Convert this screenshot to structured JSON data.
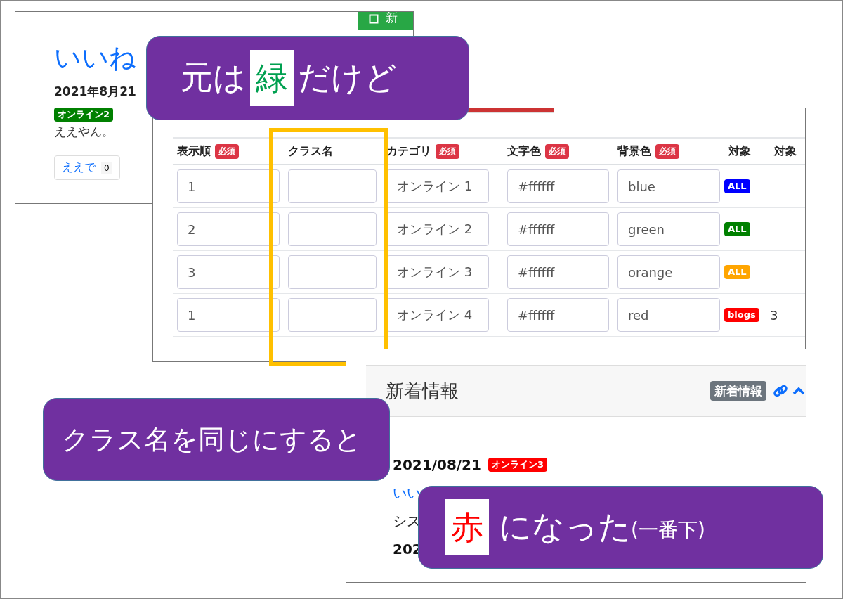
{
  "post_panel": {
    "new_button": "新",
    "title": "いいね",
    "date": "2021年8月21",
    "category_badge": {
      "text": "オンライン2",
      "color": "#008000"
    },
    "body": "ええやん。",
    "like_button": {
      "label": "ええで",
      "count": "0"
    }
  },
  "category_table": {
    "columns": [
      {
        "label": "表示順",
        "required_badge": "必須"
      },
      {
        "label": "クラス名"
      },
      {
        "label": "カテゴリ",
        "required_badge": "必須"
      },
      {
        "label": "文字色",
        "required_badge": "必須"
      },
      {
        "label": "背景色",
        "required_badge": "必須"
      },
      {
        "label": "対象"
      },
      {
        "label": "対象"
      }
    ],
    "rows": [
      {
        "order": "1",
        "category": "オンライン 1",
        "text_color": "#ffffff",
        "background": "blue",
        "target": {
          "text": "ALL",
          "color": "#0000ff"
        }
      },
      {
        "order": "2",
        "category": "オンライン 2",
        "text_color": "#ffffff",
        "background": "green",
        "target": {
          "text": "ALL",
          "color": "#008000"
        }
      },
      {
        "order": "3",
        "category": "オンライン 3",
        "text_color": "#ffffff",
        "background": "orange",
        "target": {
          "text": "ALL",
          "color": "#ffa500"
        }
      },
      {
        "order": "1",
        "category": "オンライン 4",
        "text_color": "#ffffff",
        "background": "red",
        "target": {
          "text": "blogs",
          "color": "#ff0000"
        },
        "target_count": "3"
      }
    ]
  },
  "news_panel": {
    "title": "新着情報",
    "badge": "新着情報",
    "entries": [
      {
        "kind": "dated",
        "date": "2021/08/21",
        "badge": {
          "text": "オンライン3",
          "color": "#ff0000"
        }
      },
      {
        "kind": "link",
        "text": "いい"
      },
      {
        "kind": "plain",
        "text": "シス"
      },
      {
        "kind": "dated",
        "date": "202"
      }
    ]
  },
  "callouts": [
    {
      "parts": [
        {
          "kind": "text",
          "text": "元は"
        },
        {
          "kind": "boxed",
          "text": "緑",
          "color": "#00a050"
        },
        {
          "kind": "text",
          "text": "だけど"
        }
      ]
    },
    {
      "parts": [
        {
          "kind": "text",
          "text": "クラス名を同じにすると"
        }
      ]
    },
    {
      "parts": [
        {
          "kind": "boxed",
          "text": "赤",
          "color": "#ff0000"
        },
        {
          "kind": "text",
          "text": "になった"
        },
        {
          "kind": "small",
          "text": "(一番下)"
        }
      ]
    }
  ]
}
